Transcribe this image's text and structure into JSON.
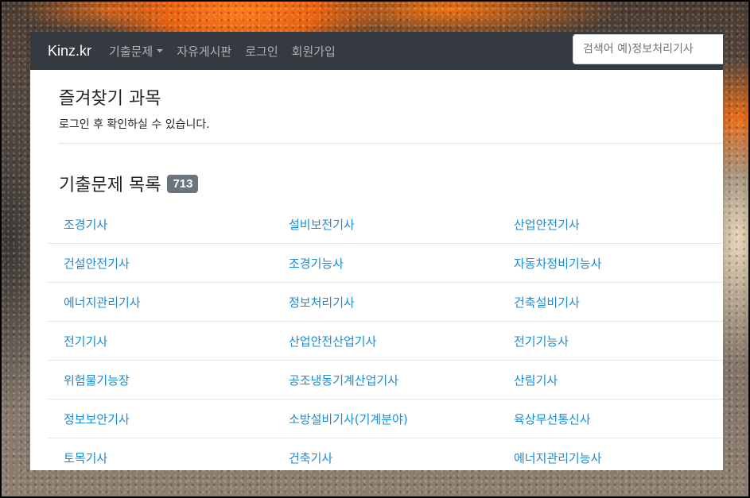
{
  "navbar": {
    "brand": "Kinz.kr",
    "items": [
      {
        "label": "기출문제",
        "dropdown": true
      },
      {
        "label": "자유게시판"
      },
      {
        "label": "로그인"
      },
      {
        "label": "회원가입"
      }
    ],
    "search_placeholder": "검색어 예)정보처리기사"
  },
  "favorites": {
    "title": "즐겨찾기 과목",
    "message": "로그인 후 확인하실 수 있습니다."
  },
  "exam_list": {
    "title": "기출문제 목록",
    "count": "713",
    "rows": [
      [
        "조경기사",
        "설비보전기사",
        "산업안전기사"
      ],
      [
        "건설안전기사",
        "조경기능사",
        "자동차정비기능사"
      ],
      [
        "에너지관리기사",
        "정보처리기사",
        "건축설비기사"
      ],
      [
        "전기기사",
        "산업안전산업기사",
        "전기기능사"
      ],
      [
        "위험물기능장",
        "공조냉동기계산업기사",
        "산림기사"
      ],
      [
        "정보보안기사",
        "소방설비기사(기계분야)",
        "육상무선통신사"
      ],
      [
        "토목기사",
        "건축기사",
        "에너지관리기능사"
      ]
    ]
  },
  "colors": {
    "navbar_bg": "#343a40",
    "link": "#1a8bd6",
    "badge_bg": "#6c757d"
  }
}
